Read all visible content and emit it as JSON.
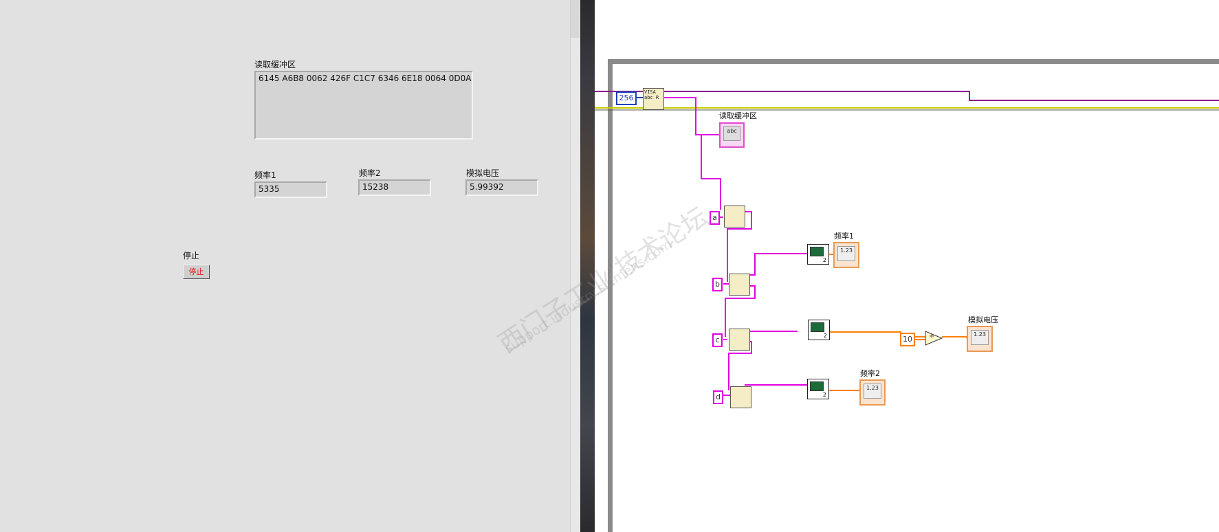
{
  "front_panel": {
    "read_buffer": {
      "label": "读取缓冲区",
      "value": "6145 A6B8 0062 426F C1C7 6346 6E18 0064 0D0A"
    },
    "freq1": {
      "label": "频率1",
      "value": "5335"
    },
    "freq2": {
      "label": "频率2",
      "value": "15238"
    },
    "analog_voltage": {
      "label": "模拟电压",
      "value": "5.99392"
    },
    "stop": {
      "label": "停止",
      "button_text": "停止"
    }
  },
  "block_diagram": {
    "const_bytes": "256",
    "visa_read_icon": "VISA abc R",
    "read_buffer_label": "读取缓冲区",
    "read_buffer_terminal_text": "abc",
    "match_patterns": [
      "a",
      "b",
      "c",
      "d"
    ],
    "freq1_label": "频率1",
    "freq2_label": "频率2",
    "analog_voltage_label": "模拟电压",
    "const_ten": "10",
    "divide_symbol": "÷",
    "numeric_terminal_text": "1.23",
    "convert_precision": "2"
  },
  "watermark": {
    "line1": "西门子工业 技术论坛",
    "line2": "support.industry.siemens.com"
  },
  "colors": {
    "string_wire": "#e000e0",
    "numeric_wire": "#ff8000",
    "loop_border": "#8a8a8a",
    "error_wire": "#c8c800",
    "stop_text": "#e0201c"
  }
}
